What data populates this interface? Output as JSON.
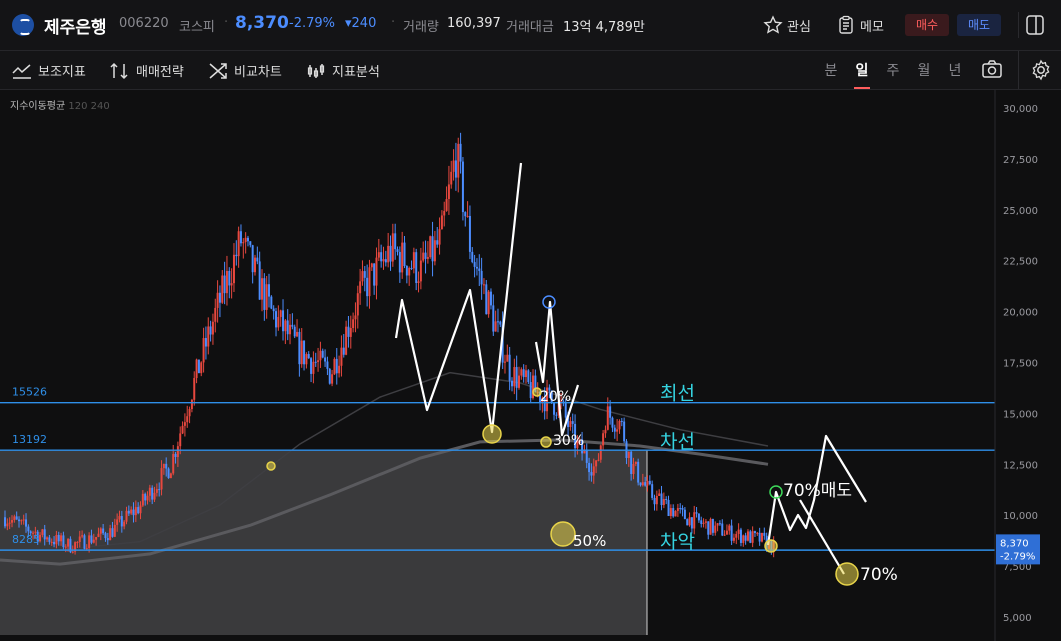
{
  "header": {
    "name": "제주은행",
    "code": "006220",
    "market": "코스피",
    "price": "8,370",
    "change_pct": "-2.79%",
    "change_amt": "▾240",
    "volume_label": "거래량",
    "volume": "160,397",
    "amount_label": "거래대금",
    "amount": "13억 4,789만",
    "watch_label": "관심",
    "memo_label": "메모",
    "buy_label": "매수",
    "sell_label": "매도"
  },
  "toolbar": {
    "tools": [
      "보조지표",
      "매매전략",
      "비교차트",
      "지표분석"
    ],
    "periods": [
      "분",
      "일",
      "주",
      "월",
      "년"
    ],
    "active_period": "일"
  },
  "chart_data": {
    "type": "candlestick",
    "indicator_title": "지수이동평균",
    "indicator_params": "120 240",
    "yticks": [
      "30,000",
      "27,500",
      "25,000",
      "22,500",
      "20,000",
      "17,500",
      "15,000",
      "12,500",
      "10,000",
      "7,500",
      "5,000"
    ],
    "ylim": [
      5000,
      30000
    ],
    "current_price": "8,370",
    "current_change": "-2.79%",
    "horizontal_lines": [
      {
        "label": "15526",
        "value": 15526,
        "annotation": "최선"
      },
      {
        "label": "13192",
        "value": 13192,
        "annotation": "차선"
      },
      {
        "label": "8285",
        "value": 8285,
        "annotation": "차악"
      }
    ],
    "annotations": [
      "20%",
      "30%",
      "50%",
      "70%매도",
      "70%"
    ],
    "colors": {
      "up": "#e8483f",
      "down": "#4c8dff",
      "line": "#2f8fe8",
      "annotation": "#35d3e0",
      "marker": "#e8d44a"
    }
  }
}
